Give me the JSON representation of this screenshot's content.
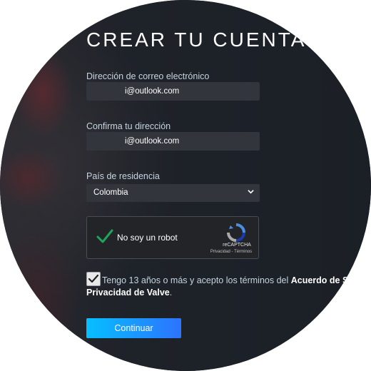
{
  "form": {
    "title": "CREAR TU CUENTA",
    "email_label": "Dirección de correo electrónico",
    "email_value": "i@outlook.com",
    "confirm_label": "Confirma tu dirección",
    "confirm_value": "i@outlook.com",
    "country_label": "País de residencia",
    "country_value": "Colombia",
    "continue_label": "Continuar"
  },
  "captcha": {
    "label": "No soy un robot",
    "brand": "reCAPTCHA",
    "links": "Privacidad - Términos",
    "checked": true
  },
  "agreement": {
    "checked": true,
    "text_start": "Tengo 13 años o más y acepto los términos del ",
    "link_1": "Acuerdo de Sus",
    "link_2": "Privacidad de Valve",
    "text_end": "."
  },
  "icons": {
    "check": "checkmark-icon",
    "chevron": "chevron-down-icon",
    "recaptcha": "recaptcha-logo-icon"
  },
  "colors": {
    "background": "#1b1f26",
    "field": "#32353c",
    "label": "#c6d4df",
    "button_start": "#06bfff",
    "button_end": "#2d73ff",
    "captcha_check": "#1fa55a"
  }
}
